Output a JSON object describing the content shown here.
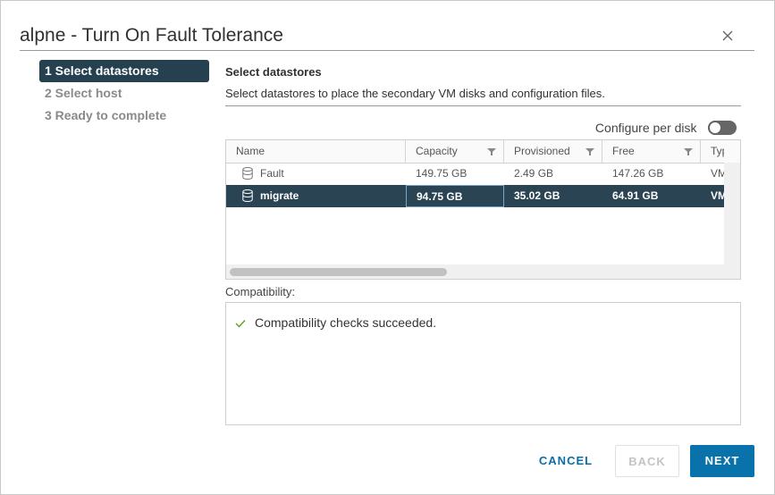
{
  "dialog": {
    "title": "alpne - Turn On Fault Tolerance",
    "close_icon": "close-icon"
  },
  "steps": [
    {
      "label": "1 Select datastores",
      "active": true
    },
    {
      "label": "2 Select host",
      "active": false
    },
    {
      "label": "3 Ready to complete",
      "active": false
    }
  ],
  "section": {
    "title": "Select datastores",
    "description": "Select datastores to place the secondary VM disks and configuration files."
  },
  "toggle": {
    "label": "Configure per disk",
    "on": false
  },
  "grid": {
    "columns": [
      {
        "label": "Name",
        "filter": false
      },
      {
        "label": "Capacity",
        "filter": true
      },
      {
        "label": "Provisioned",
        "filter": true
      },
      {
        "label": "Free",
        "filter": true
      },
      {
        "label": "Typ",
        "filter": false
      }
    ],
    "rows": [
      {
        "name": "Fault",
        "capacity": "149.75 GB",
        "provisioned": "2.49 GB",
        "free": "147.26 GB",
        "type": "VM",
        "selected": false
      },
      {
        "name": "migrate",
        "capacity": "94.75 GB",
        "provisioned": "35.02 GB",
        "free": "64.91 GB",
        "type": "VM",
        "selected": true
      }
    ]
  },
  "compatibility": {
    "label": "Compatibility:",
    "message": "Compatibility checks succeeded."
  },
  "buttons": {
    "cancel": "CANCEL",
    "back": "BACK",
    "next": "NEXT"
  },
  "colors": {
    "accent": "#0a72ab",
    "active_step": "#25404f",
    "selected_row": "#2b4454",
    "success": "#5aa220"
  }
}
